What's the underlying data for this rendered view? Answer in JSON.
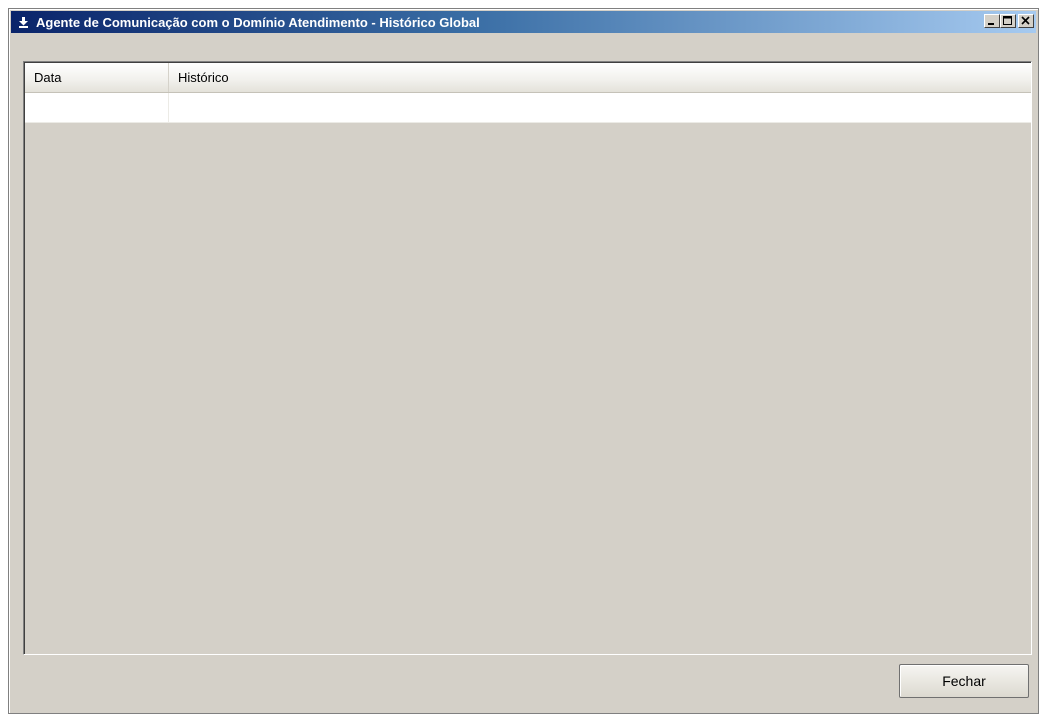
{
  "window": {
    "title": "Agente de Comunicação com o Domínio Atendimento - Histórico Global",
    "icon": "download-arrow-icon"
  },
  "caption_buttons": {
    "minimize": "minimize-icon",
    "maximize": "maximize-icon",
    "close": "close-icon"
  },
  "grid": {
    "columns": [
      {
        "label": "Data"
      },
      {
        "label": "Histórico"
      }
    ],
    "rows": [
      {
        "data": "",
        "historico": ""
      }
    ]
  },
  "footer": {
    "close_label": "Fechar"
  },
  "colors": {
    "titlebar_start": "#0a246a",
    "titlebar_end": "#a6caf0",
    "face": "#d4d0c8"
  }
}
